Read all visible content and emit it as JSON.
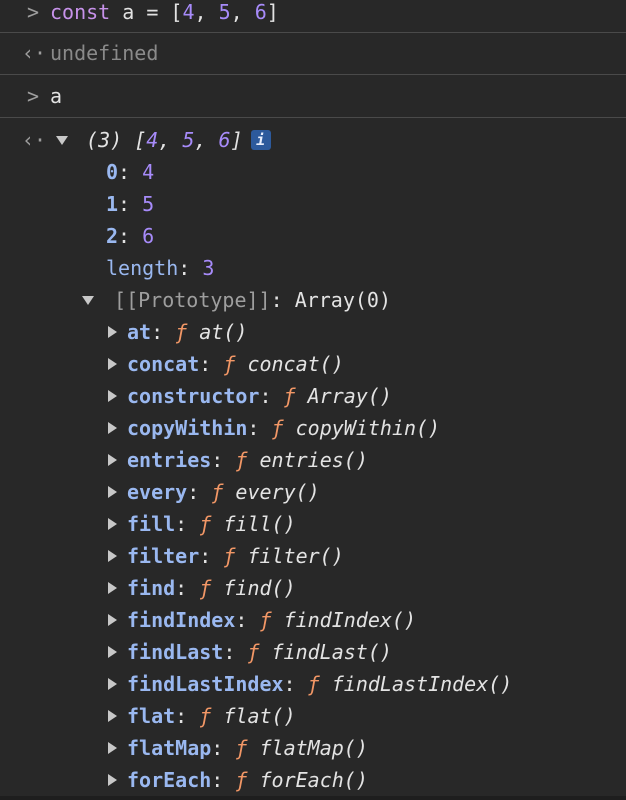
{
  "entries": {
    "input1": {
      "prompt": ">",
      "keyword": "const",
      "rest_a": " a = [",
      "n1": "4",
      "c1": ", ",
      "n2": "5",
      "c2": ", ",
      "n3": "6",
      "close": "]"
    },
    "output1": {
      "prompt": "‹·",
      "value": "undefined"
    },
    "input2": {
      "prompt": ">",
      "value": "a"
    },
    "output2": {
      "prompt": "‹·",
      "count": "(3)",
      "open": " [",
      "n1": "4",
      "c1": ", ",
      "n2": "5",
      "c2": ", ",
      "n3": "6",
      "close": "]",
      "info": "i"
    }
  },
  "array_items": [
    {
      "key": "0",
      "value": "4"
    },
    {
      "key": "1",
      "value": "5"
    },
    {
      "key": "2",
      "value": "6"
    }
  ],
  "length_row": {
    "key": "length",
    "value": "3"
  },
  "prototype_row": {
    "key": "[[Prototype]]",
    "value": "Array(0)"
  },
  "prototype_members": [
    {
      "name": "at",
      "func": "at()"
    },
    {
      "name": "concat",
      "func": "concat()"
    },
    {
      "name": "constructor",
      "func": "Array()"
    },
    {
      "name": "copyWithin",
      "func": "copyWithin()"
    },
    {
      "name": "entries",
      "func": "entries()"
    },
    {
      "name": "every",
      "func": "every()"
    },
    {
      "name": "fill",
      "func": "fill()"
    },
    {
      "name": "filter",
      "func": "filter()"
    },
    {
      "name": "find",
      "func": "find()"
    },
    {
      "name": "findIndex",
      "func": "findIndex()"
    },
    {
      "name": "findLast",
      "func": "findLast()"
    },
    {
      "name": "findLastIndex",
      "func": "findLastIndex()"
    },
    {
      "name": "flat",
      "func": "flat()"
    },
    {
      "name": "flatMap",
      "func": "flatMap()"
    },
    {
      "name": "forEach",
      "func": "forEach()"
    }
  ],
  "separators": {
    "colon": ": ",
    "f_symbol": "ƒ",
    "space": " "
  },
  "colors": {
    "background": "#282828",
    "keyword": "#c792ea",
    "number": "#a78bfa",
    "key": "#9ab8f0",
    "function_symbol": "#f29766",
    "muted": "#8a8a8a"
  }
}
